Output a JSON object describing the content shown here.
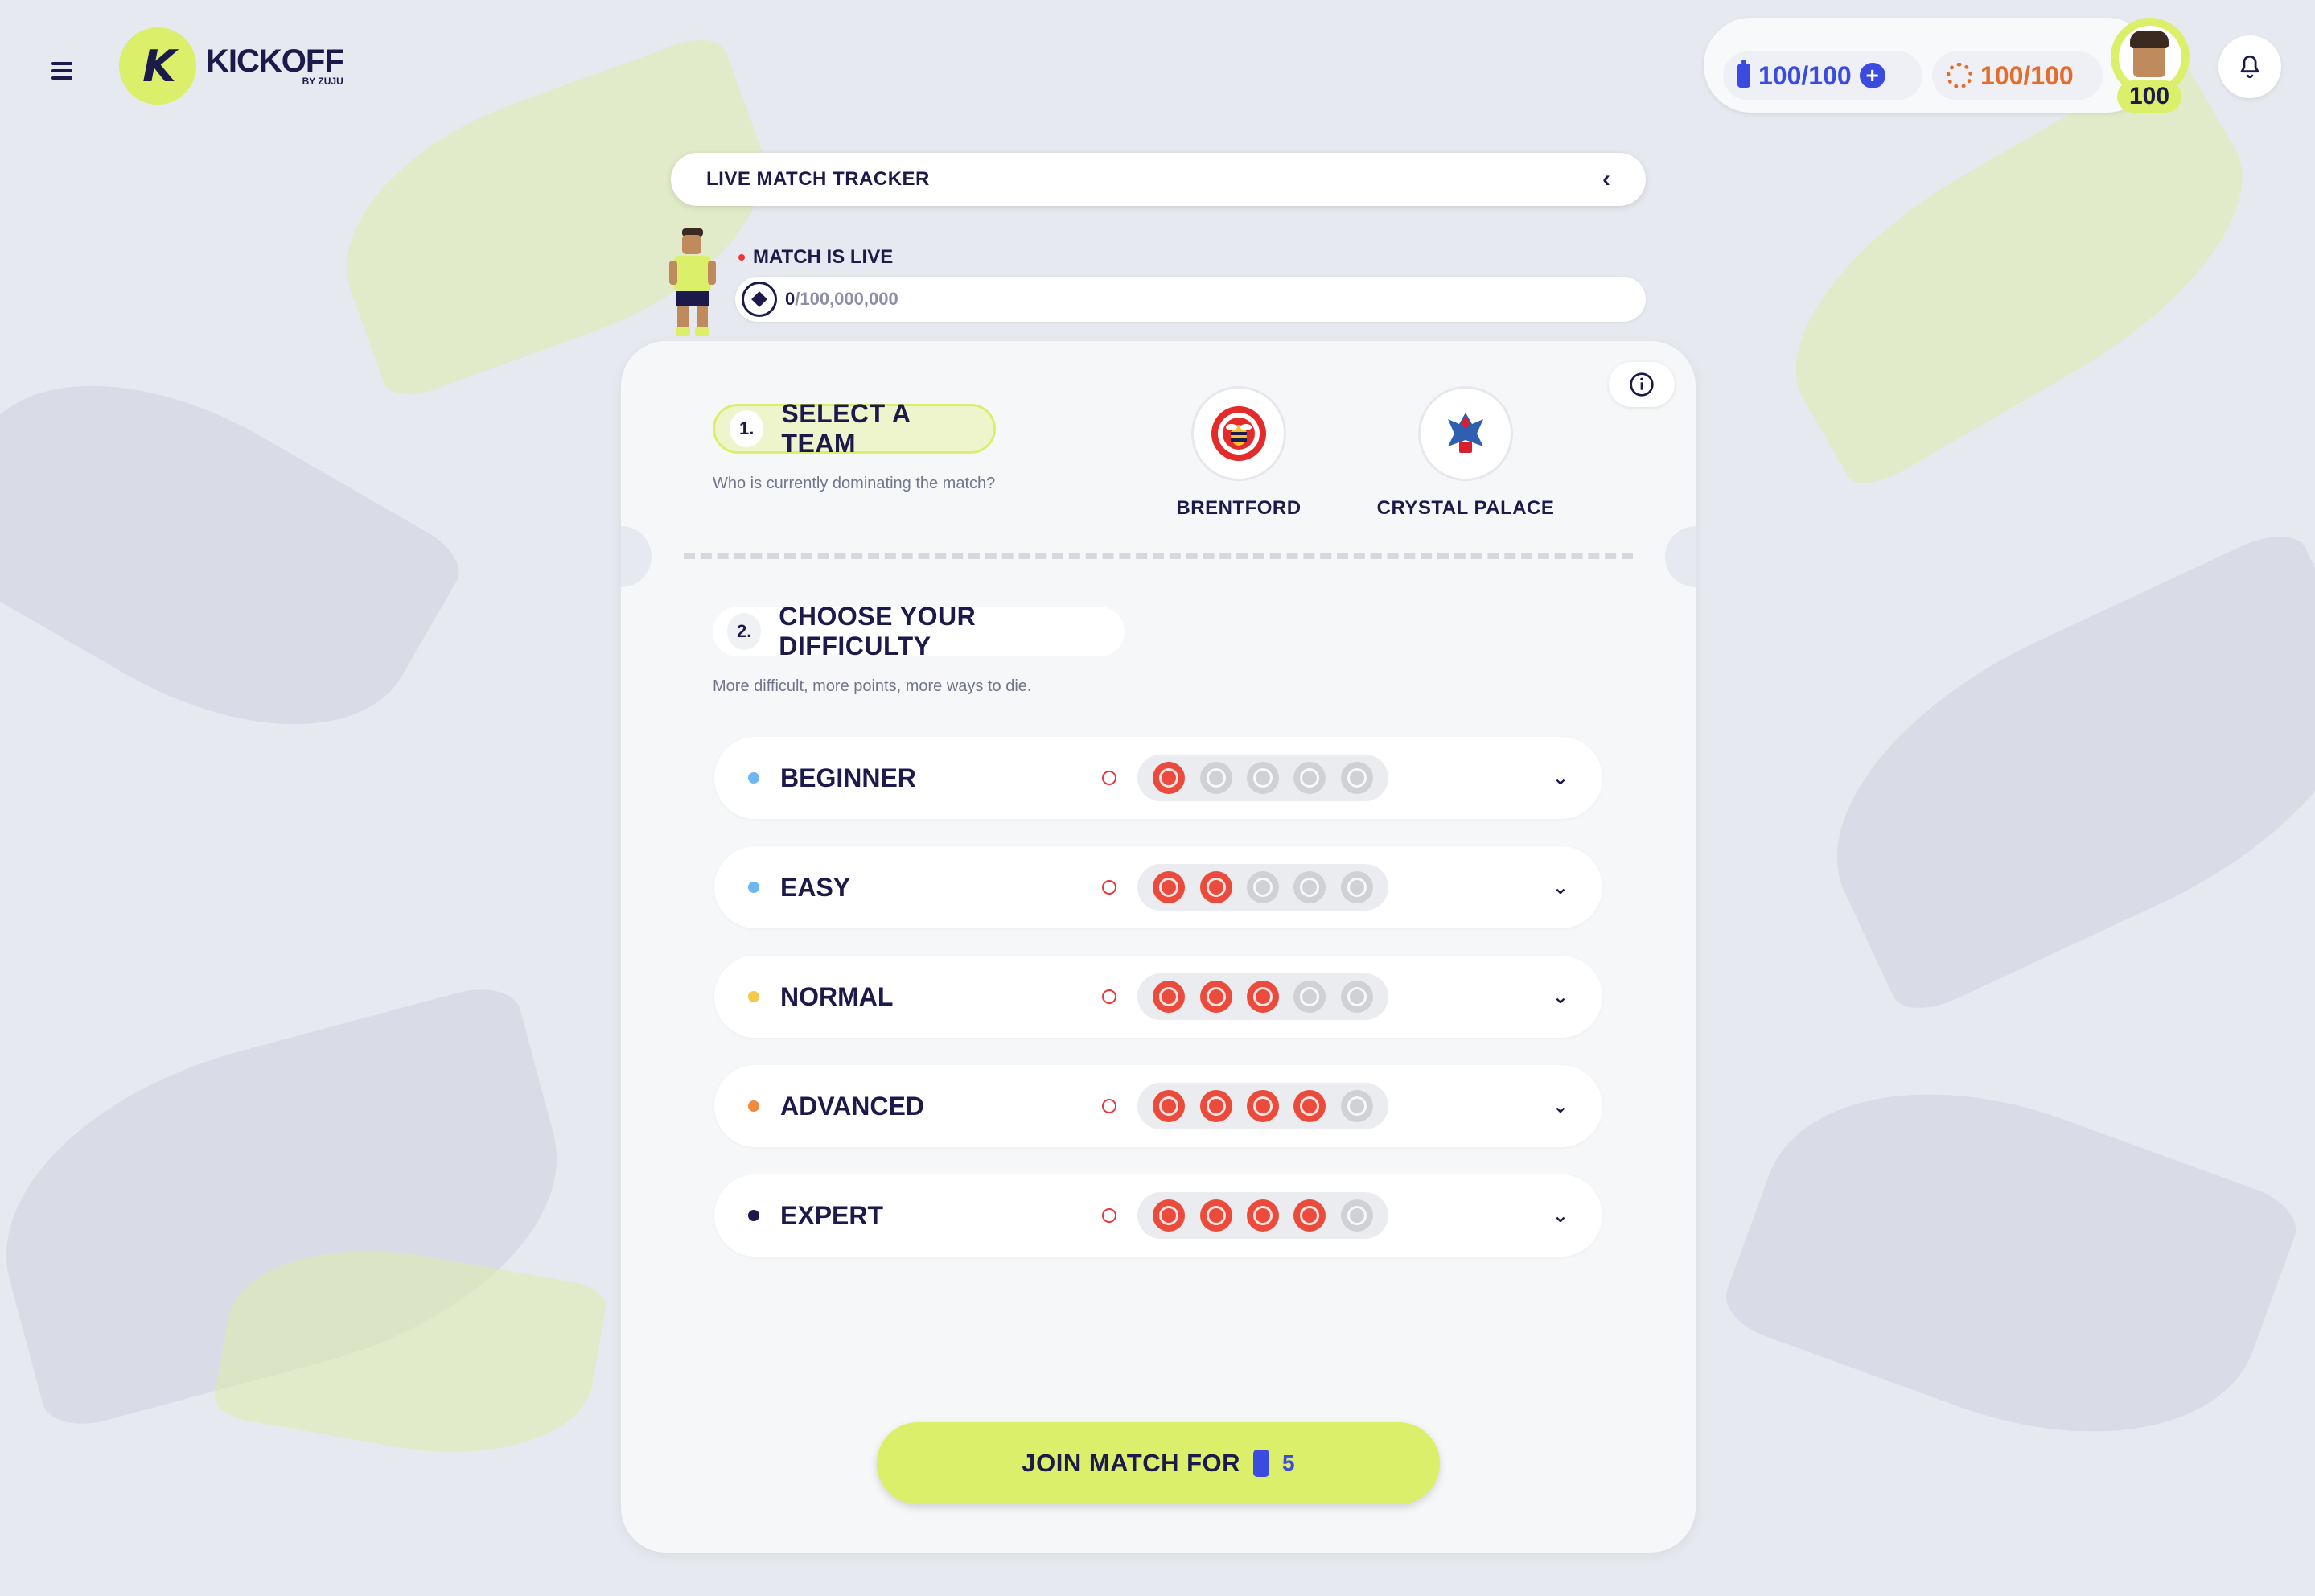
{
  "colors": {
    "brand_lime": "#dcef6a",
    "navy": "#1b1a4a",
    "energy_blue": "#3b4bdf",
    "coin_orange": "#e46d2c",
    "live_red": "#e9373a"
  },
  "header": {
    "menu_icon": "hamburger-menu-icon",
    "logo_title": "KICKOFF",
    "logo_sub": "BY ZUJU",
    "energy": "100/100",
    "coins": "100/100",
    "level": "100",
    "notification_icon": "bell-icon"
  },
  "tracker": {
    "title": "LIVE MATCH TRACKER",
    "collapse_icon": "chevron-left-icon",
    "live_label": "MATCH IS LIVE",
    "progress_current": "0",
    "progress_total": "/100,000,000"
  },
  "step1": {
    "number": "1.",
    "title": "SELECT A TEAM",
    "description": "Who is currently dominating the match?",
    "teams": [
      {
        "name": "BRENTFORD",
        "icon": "bee-crest-icon"
      },
      {
        "name": "CRYSTAL PALACE",
        "icon": "eagle-crest-icon"
      }
    ]
  },
  "step2": {
    "number": "2.",
    "title": "CHOOSE YOUR DIFFICULTY",
    "description": "More difficult, more points, more ways to die.",
    "levels": [
      {
        "name": "BEGINNER",
        "dot_color": "#6fb6f0",
        "active_icons": 1
      },
      {
        "name": "EASY",
        "dot_color": "#6fb6f0",
        "active_icons": 2
      },
      {
        "name": "NORMAL",
        "dot_color": "#f2c94c",
        "active_icons": 3
      },
      {
        "name": "ADVANCED",
        "dot_color": "#f08a3c",
        "active_icons": 4
      },
      {
        "name": "EXPERT",
        "dot_color": "#1b1a4a",
        "active_icons": 4
      }
    ]
  },
  "join": {
    "label": "JOIN MATCH FOR",
    "cost": "5"
  }
}
